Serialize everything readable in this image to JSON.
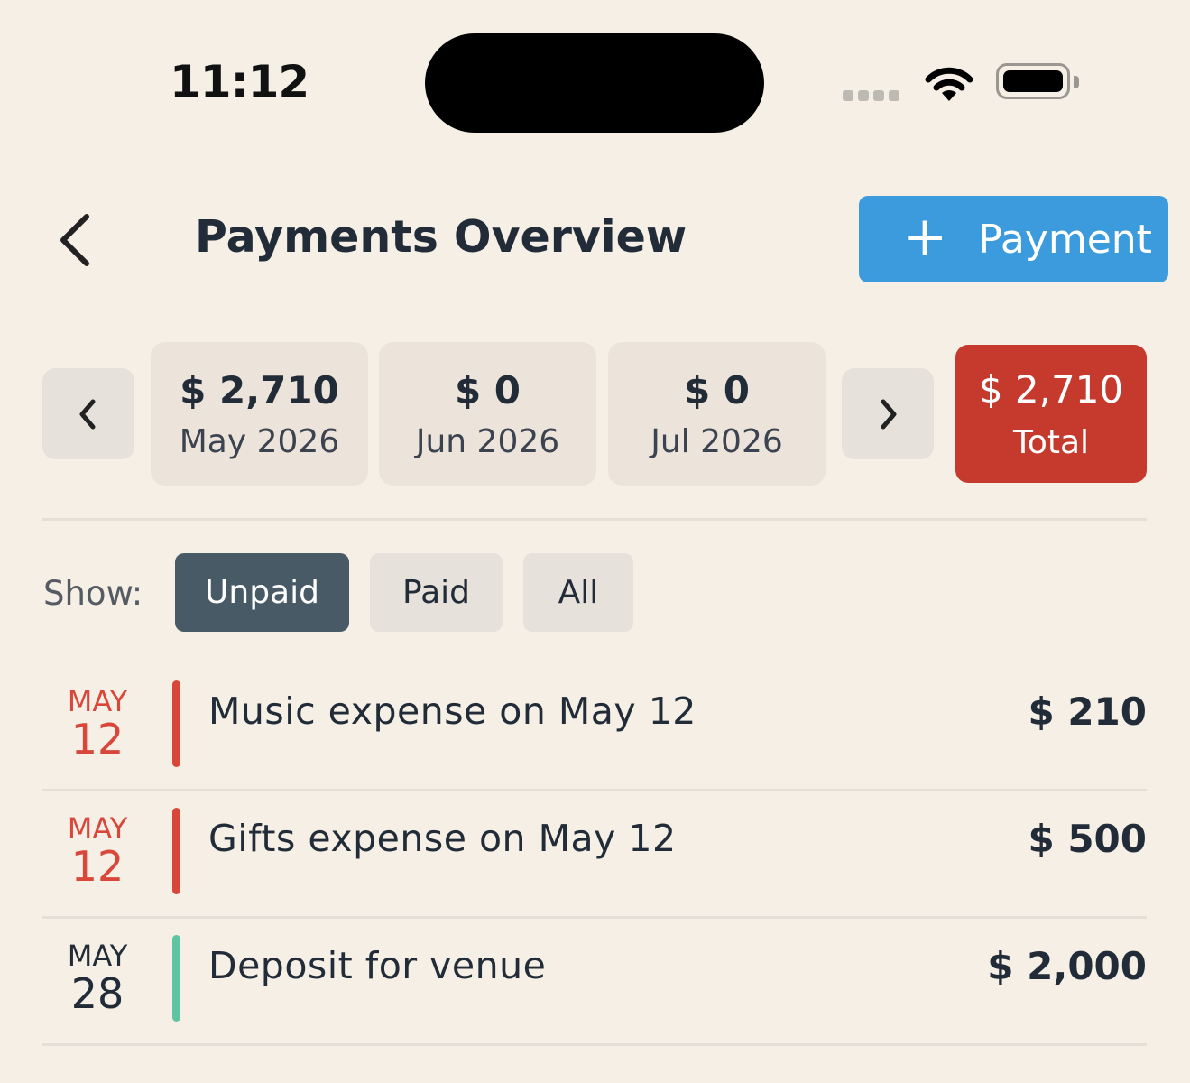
{
  "status_bar": {
    "time": "11:12"
  },
  "header": {
    "title": "Payments Overview",
    "add_button_icon": "plus-icon",
    "add_button_label": "Payment"
  },
  "months": [
    {
      "amount": "$ 2,710",
      "label": "May 2026"
    },
    {
      "amount": "$ 0",
      "label": "Jun 2026"
    },
    {
      "amount": "$ 0",
      "label": "Jul 2026"
    }
  ],
  "total": {
    "amount": "$ 2,710",
    "label": "Total",
    "color": "#c53a2d"
  },
  "filter": {
    "label": "Show:",
    "options": [
      "Unpaid",
      "Paid",
      "All"
    ],
    "selected": "Unpaid"
  },
  "payments": [
    {
      "month": "MAY",
      "day": "12",
      "description": "Music expense on May 12",
      "amount": "$ 210",
      "date_color": "#d9473a",
      "bar_color": "#d9473a"
    },
    {
      "month": "MAY",
      "day": "12",
      "description": "Gifts expense on May 12",
      "amount": "$ 500",
      "date_color": "#d9473a",
      "bar_color": "#d9473a"
    },
    {
      "month": "MAY",
      "day": "28",
      "description": "Deposit for venue",
      "amount": "$ 2,000",
      "date_color": "#222c38",
      "bar_color": "#5fc4a0"
    }
  ],
  "colors": {
    "accent": "#3b9bdc",
    "background": "#f5efe6",
    "selected_chip": "#485a66"
  }
}
